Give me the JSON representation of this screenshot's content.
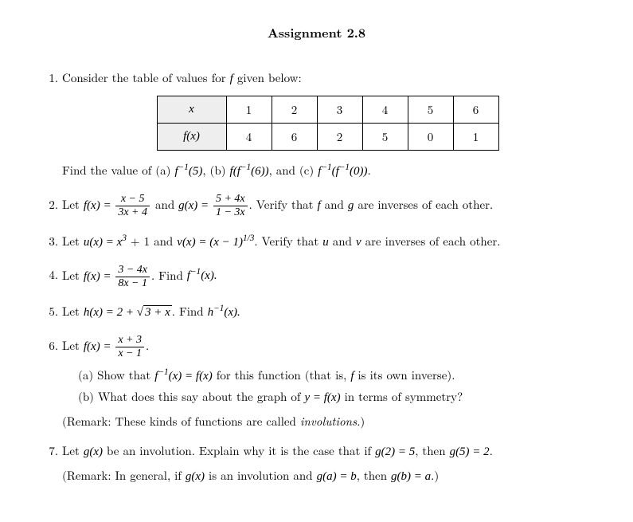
{
  "title": "Assignment 2.8",
  "q1": {
    "intro": "Consider the table of values for ",
    "intro2": " given below:",
    "row1h": "x",
    "row2h": "f(x)",
    "c": [
      "1",
      "2",
      "3",
      "4",
      "5",
      "6"
    ],
    "v": [
      "4",
      "6",
      "2",
      "5",
      "0",
      "1"
    ],
    "find_a": "Find the value of (a) ",
    "f1": "f",
    "inv": "−1",
    "p5": "(5)",
    "sep_b": ", (b) ",
    "ff6": "f(f",
    "p6": "(6))",
    "sep_c": ", and (c) ",
    "p0": "(0))",
    "dot": "."
  },
  "q2": {
    "let": "Let ",
    "fx": "f(x) = ",
    "num1": "x − 5",
    "den1": "3x + 4",
    "and": " and ",
    "gx": "g(x) = ",
    "num2": "5 + 4x",
    "den2": "1 − 3x",
    "verify": ". Verify that ",
    "f": "f",
    "andw": " and ",
    "g": "g",
    "tail": " are inverses of each other."
  },
  "q3": {
    "let": "Let ",
    "ux": "u(x) = x",
    "p3": "3",
    "plus1": " + 1 and ",
    "vx": "v(x) = (x − 1)",
    "p13": "1/3",
    "verify": ". Verify that ",
    "u": "u",
    "andw": " and ",
    "v": "v",
    "tail": " are inverses of each other."
  },
  "q4": {
    "let": "Let ",
    "fx": "f(x) = ",
    "num": "3 − 4x",
    "den": "8x − 1",
    "find": ". Find ",
    "f": "f",
    "inv": "−1",
    "xp": "(x).",
    "dot": ""
  },
  "q5": {
    "let": "Let ",
    "hx": "h(x) = 2 + ",
    "rad": "3 + x",
    "find": ". Find ",
    "h": "h",
    "inv": "−1",
    "xp": "(x)."
  },
  "q6": {
    "let": "Let ",
    "fx": "f(x) = ",
    "num": "x + 3",
    "den": "x − 1",
    "dot": ".",
    "a1": "(a) Show that ",
    "f": "f",
    "inv": "−1",
    "a2": "(x) = f(x)",
    "a3": " for this function (that is, ",
    "a4": " is its own inverse).",
    "b1": "(b) What does this say about the graph of ",
    "b2": "y = f(x)",
    "b3": " in terms of symmetry?",
    "rem1": "(Remark: These kinds of functions are called ",
    "rem2": "involutions",
    "rem3": ".)"
  },
  "q7": {
    "p1": "Let ",
    "gx": "g(x)",
    "p2": " be an involution. Explain why it is the case that if ",
    "g2": "g(2) = 5",
    "p3": ", then ",
    "g5": "g(5) = 2",
    "dot": ".",
    "rem1": "(Remark: In general, if ",
    "rem_gx": "g(x)",
    "rem2": " is an involution and ",
    "ga": "g(a) = b",
    "rem3": ", then ",
    "gb": "g(b) = a",
    "rem4": ".)"
  }
}
